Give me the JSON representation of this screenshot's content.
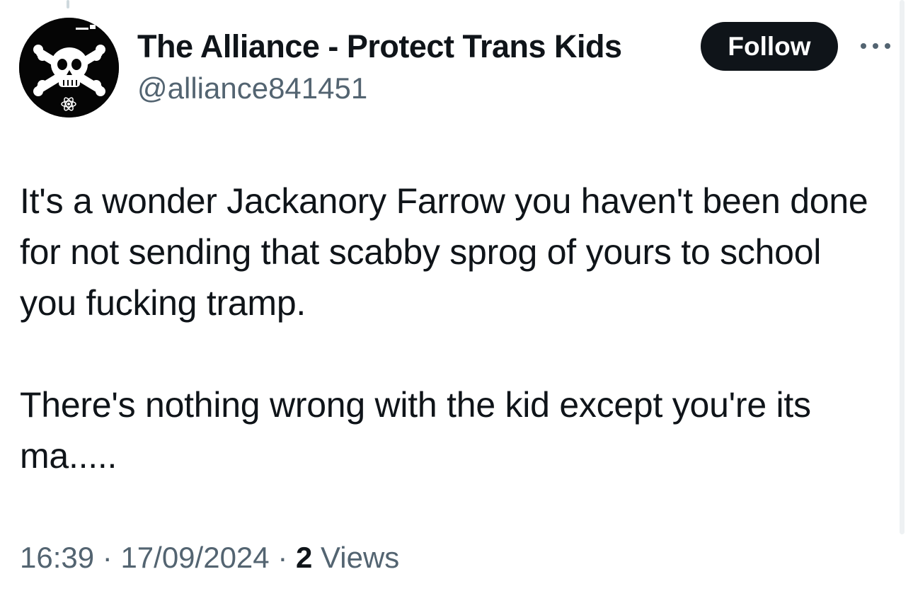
{
  "author": {
    "display_name": "The Alliance - Protect Trans Kids",
    "handle": "@alliance841451",
    "avatar_icon": "skull-crossbones-icon"
  },
  "actions": {
    "follow_label": "Follow",
    "more_icon": "more-options-icon"
  },
  "tweet": {
    "text": "It's a wonder Jackanory Farrow you haven't been done for not sending that scabby sprog of yours to school you fucking tramp.\n\nThere's nothing wrong with the kid except you're its ma.....",
    "time": "16:39",
    "separator_1": " · ",
    "date": "17/09/2024",
    "separator_2": " · ",
    "views_count": "2",
    "views_label": " Views"
  },
  "colors": {
    "primary_text": "#0f1419",
    "secondary_text": "#536471",
    "follow_bg": "#0f1419",
    "follow_text": "#ffffff"
  }
}
